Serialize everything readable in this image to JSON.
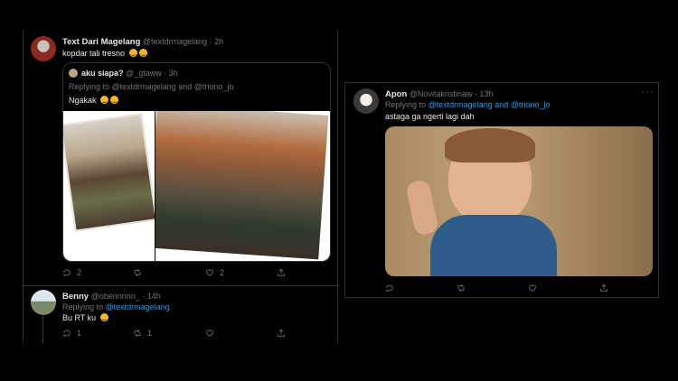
{
  "left_tweet": {
    "author_name": "Text Dari Magelang",
    "author_handle": "@textdrmagelang",
    "time": "· 2h",
    "text": "kopdar tali tresno",
    "quoted": {
      "author_name": "aku siapa?",
      "author_handle": "@_gtaww",
      "time": "· 3h",
      "reply_prefix": "Replying to ",
      "reply_mentions": "@textdrmagelang and @triono_jo",
      "text": "Ngakak"
    },
    "actions": {
      "reply_count": "2",
      "retweet_count": "",
      "like_count": "2"
    }
  },
  "reply_tweet": {
    "author_name": "Benny",
    "author_handle": "@obennnnn_",
    "time": "· 14h",
    "reply_prefix": "Replying to ",
    "reply_mentions": "@textdrmagelang",
    "text": "Bu RT ku",
    "actions": {
      "reply_count": "1",
      "retweet_count": "1",
      "like_count": ""
    }
  },
  "right_tweet": {
    "author_name": "Apon",
    "author_handle": "@Novitakristinaw",
    "time": "· 13h",
    "reply_prefix": "Replying to ",
    "reply_mentions": "@textdrmagelang and @triono_jo",
    "text": "astaga ga ngerti lagi dah"
  },
  "icons": [
    "reply-icon",
    "retweet-icon",
    "like-icon",
    "share-icon",
    "more-icon"
  ],
  "colors": {
    "background": "#000000",
    "link": "#1d9bf0",
    "muted": "#71767b",
    "border": "#2f3336"
  }
}
